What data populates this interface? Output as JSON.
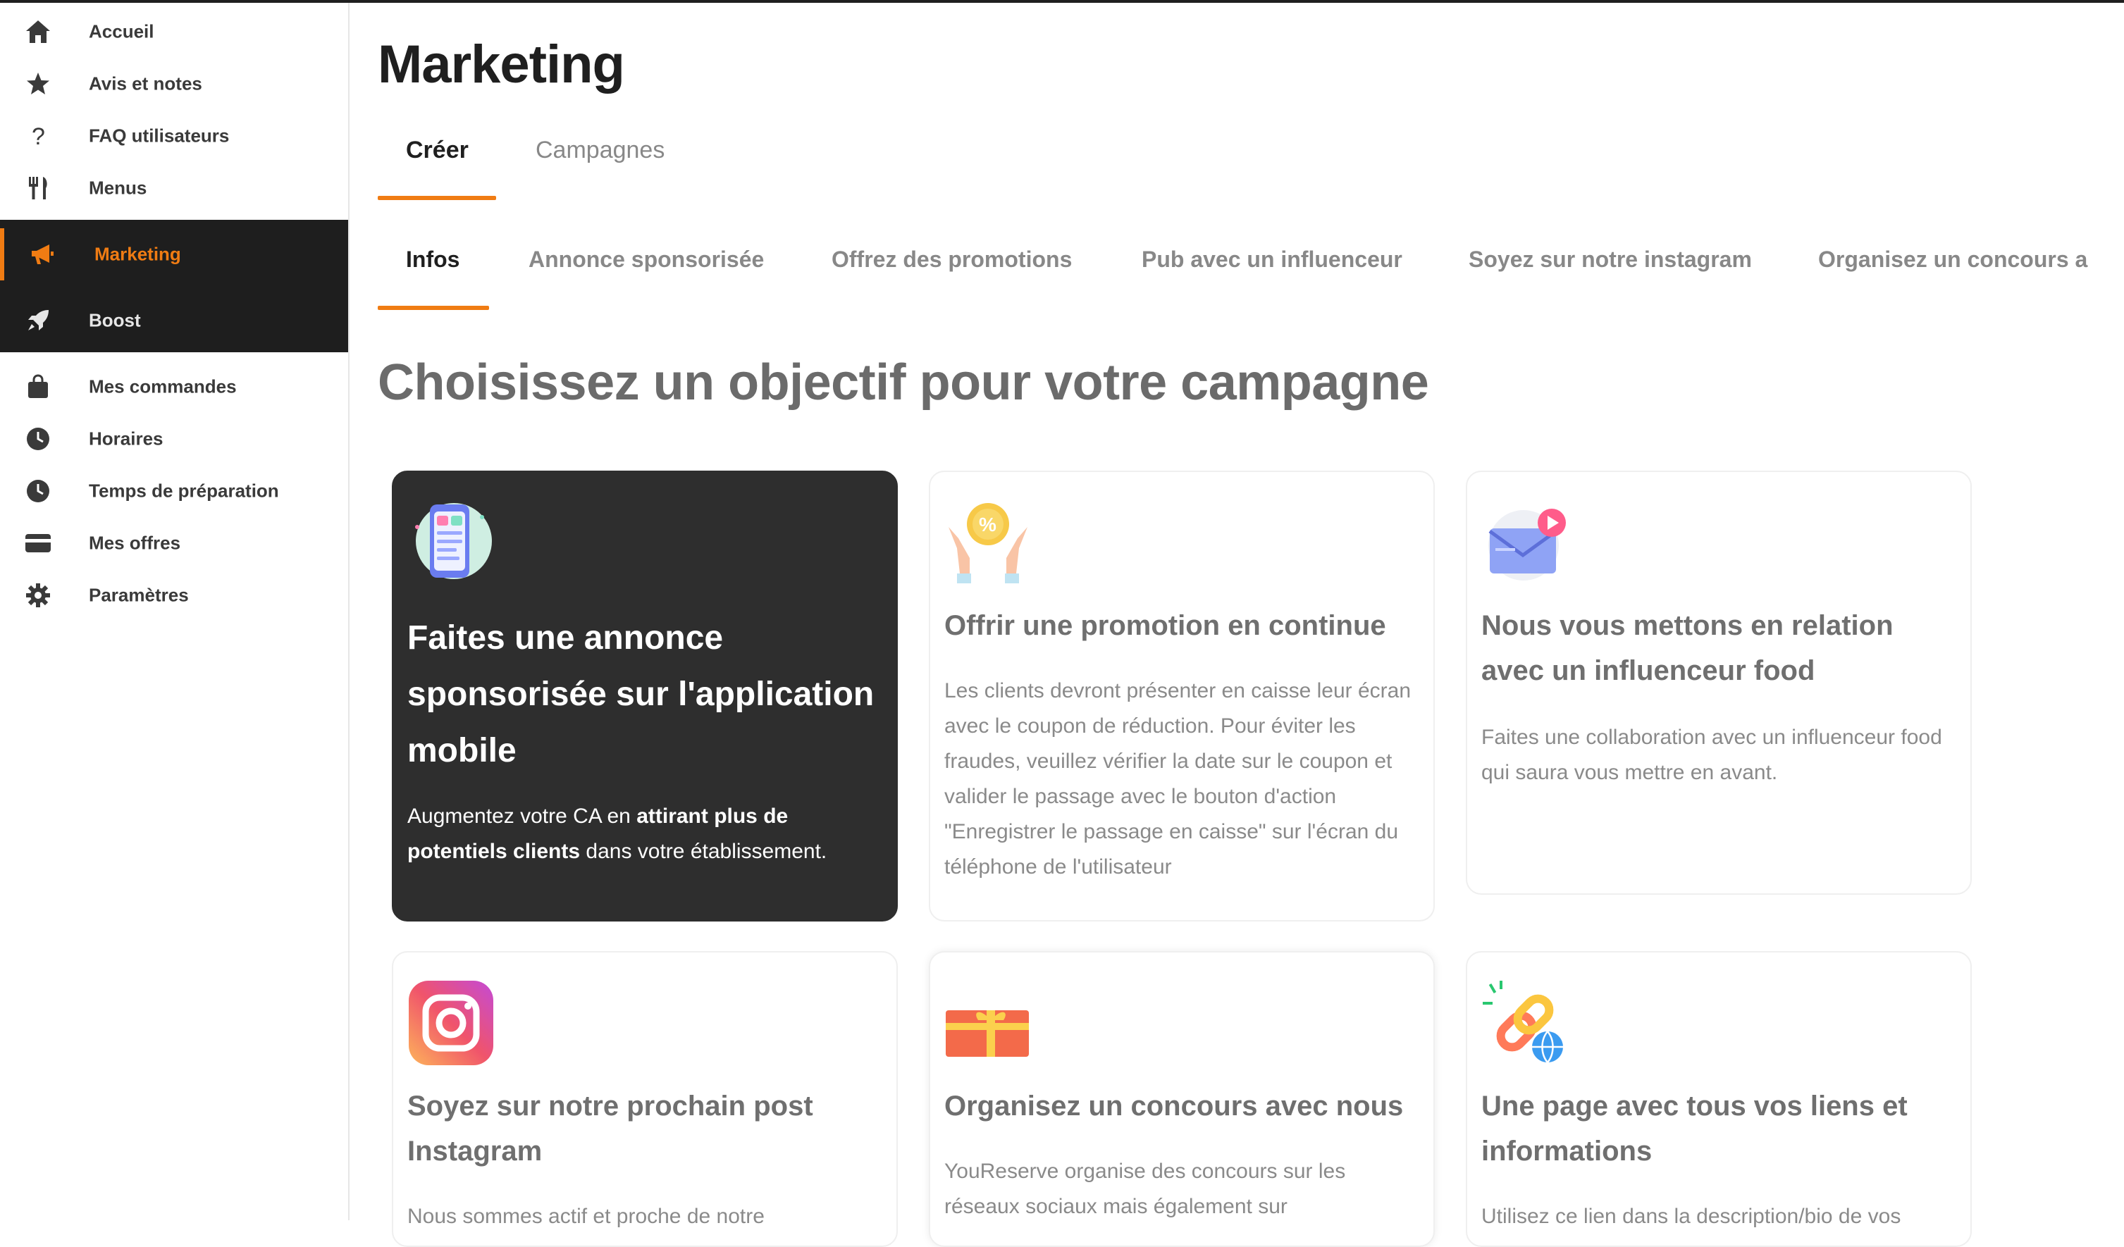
{
  "sidebar": {
    "items": [
      {
        "label": "Accueil",
        "icon": "home-icon"
      },
      {
        "label": "Avis et notes",
        "icon": "star-icon"
      },
      {
        "label": "FAQ utilisateurs",
        "icon": "question-icon"
      },
      {
        "label": "Menus",
        "icon": "cutlery-icon"
      },
      {
        "label": "Marketing",
        "icon": "megaphone-icon",
        "active": true
      },
      {
        "label": "Boost",
        "icon": "rocket-icon"
      },
      {
        "label": "Mes commandes",
        "icon": "bag-icon"
      },
      {
        "label": "Horaires",
        "icon": "clock-icon"
      },
      {
        "label": "Temps de préparation",
        "icon": "clock-icon"
      },
      {
        "label": "Mes offres",
        "icon": "card-icon"
      },
      {
        "label": "Paramètres",
        "icon": "gear-icon"
      }
    ]
  },
  "main": {
    "title": "Marketing",
    "tabs": [
      {
        "label": "Créer",
        "active": true
      },
      {
        "label": "Campagnes"
      }
    ],
    "subtabs": [
      {
        "label": "Infos",
        "active": true
      },
      {
        "label": "Annonce sponsorisée"
      },
      {
        "label": "Offrez des promotions"
      },
      {
        "label": "Pub avec un influenceur"
      },
      {
        "label": "Soyez sur notre instagram"
      },
      {
        "label": "Organisez un concours a"
      }
    ],
    "section_title": "Choisissez un objectif pour votre campagne",
    "cards": [
      {
        "icon": "phone-ads-icon",
        "title": "Faites une annonce sponsorisée sur l'application mobile",
        "desc_parts": [
          "Augmentez votre CA en ",
          "attirant plus de potentiels clients",
          " dans votre établissement."
        ]
      },
      {
        "icon": "promotion-hands-icon",
        "title": "Offrir une promotion en continue",
        "desc": "Les clients devront présenter en caisse leur écran avec le coupon de réduction. Pour éviter les fraudes, veuillez vérifier la date sur le coupon et valider le passage avec le bouton d'action \"Enregistrer le passage en caisse\" sur l'écran du téléphone de l'utilisateur"
      },
      {
        "icon": "influencer-mail-icon",
        "title": "Nous vous mettons en relation avec un influenceur food",
        "desc": "Faites une collaboration avec un influenceur food qui saura vous mettre en avant."
      },
      {
        "icon": "instagram-icon",
        "title": "Soyez sur notre prochain post Instagram",
        "desc": "Nous sommes actif et proche de notre"
      },
      {
        "icon": "gift-card-icon",
        "title": "Organisez un concours avec nous",
        "desc": "YouReserve organise des concours sur les réseaux sociaux mais également sur"
      },
      {
        "icon": "link-globe-icon",
        "title": "Une page avec tous vos liens et informations",
        "desc": "Utilisez ce lien dans la description/bio de vos"
      }
    ]
  },
  "colors": {
    "accent": "#f07c13",
    "dark": "#1e1e1e",
    "card_dark": "#2e2e2e"
  }
}
